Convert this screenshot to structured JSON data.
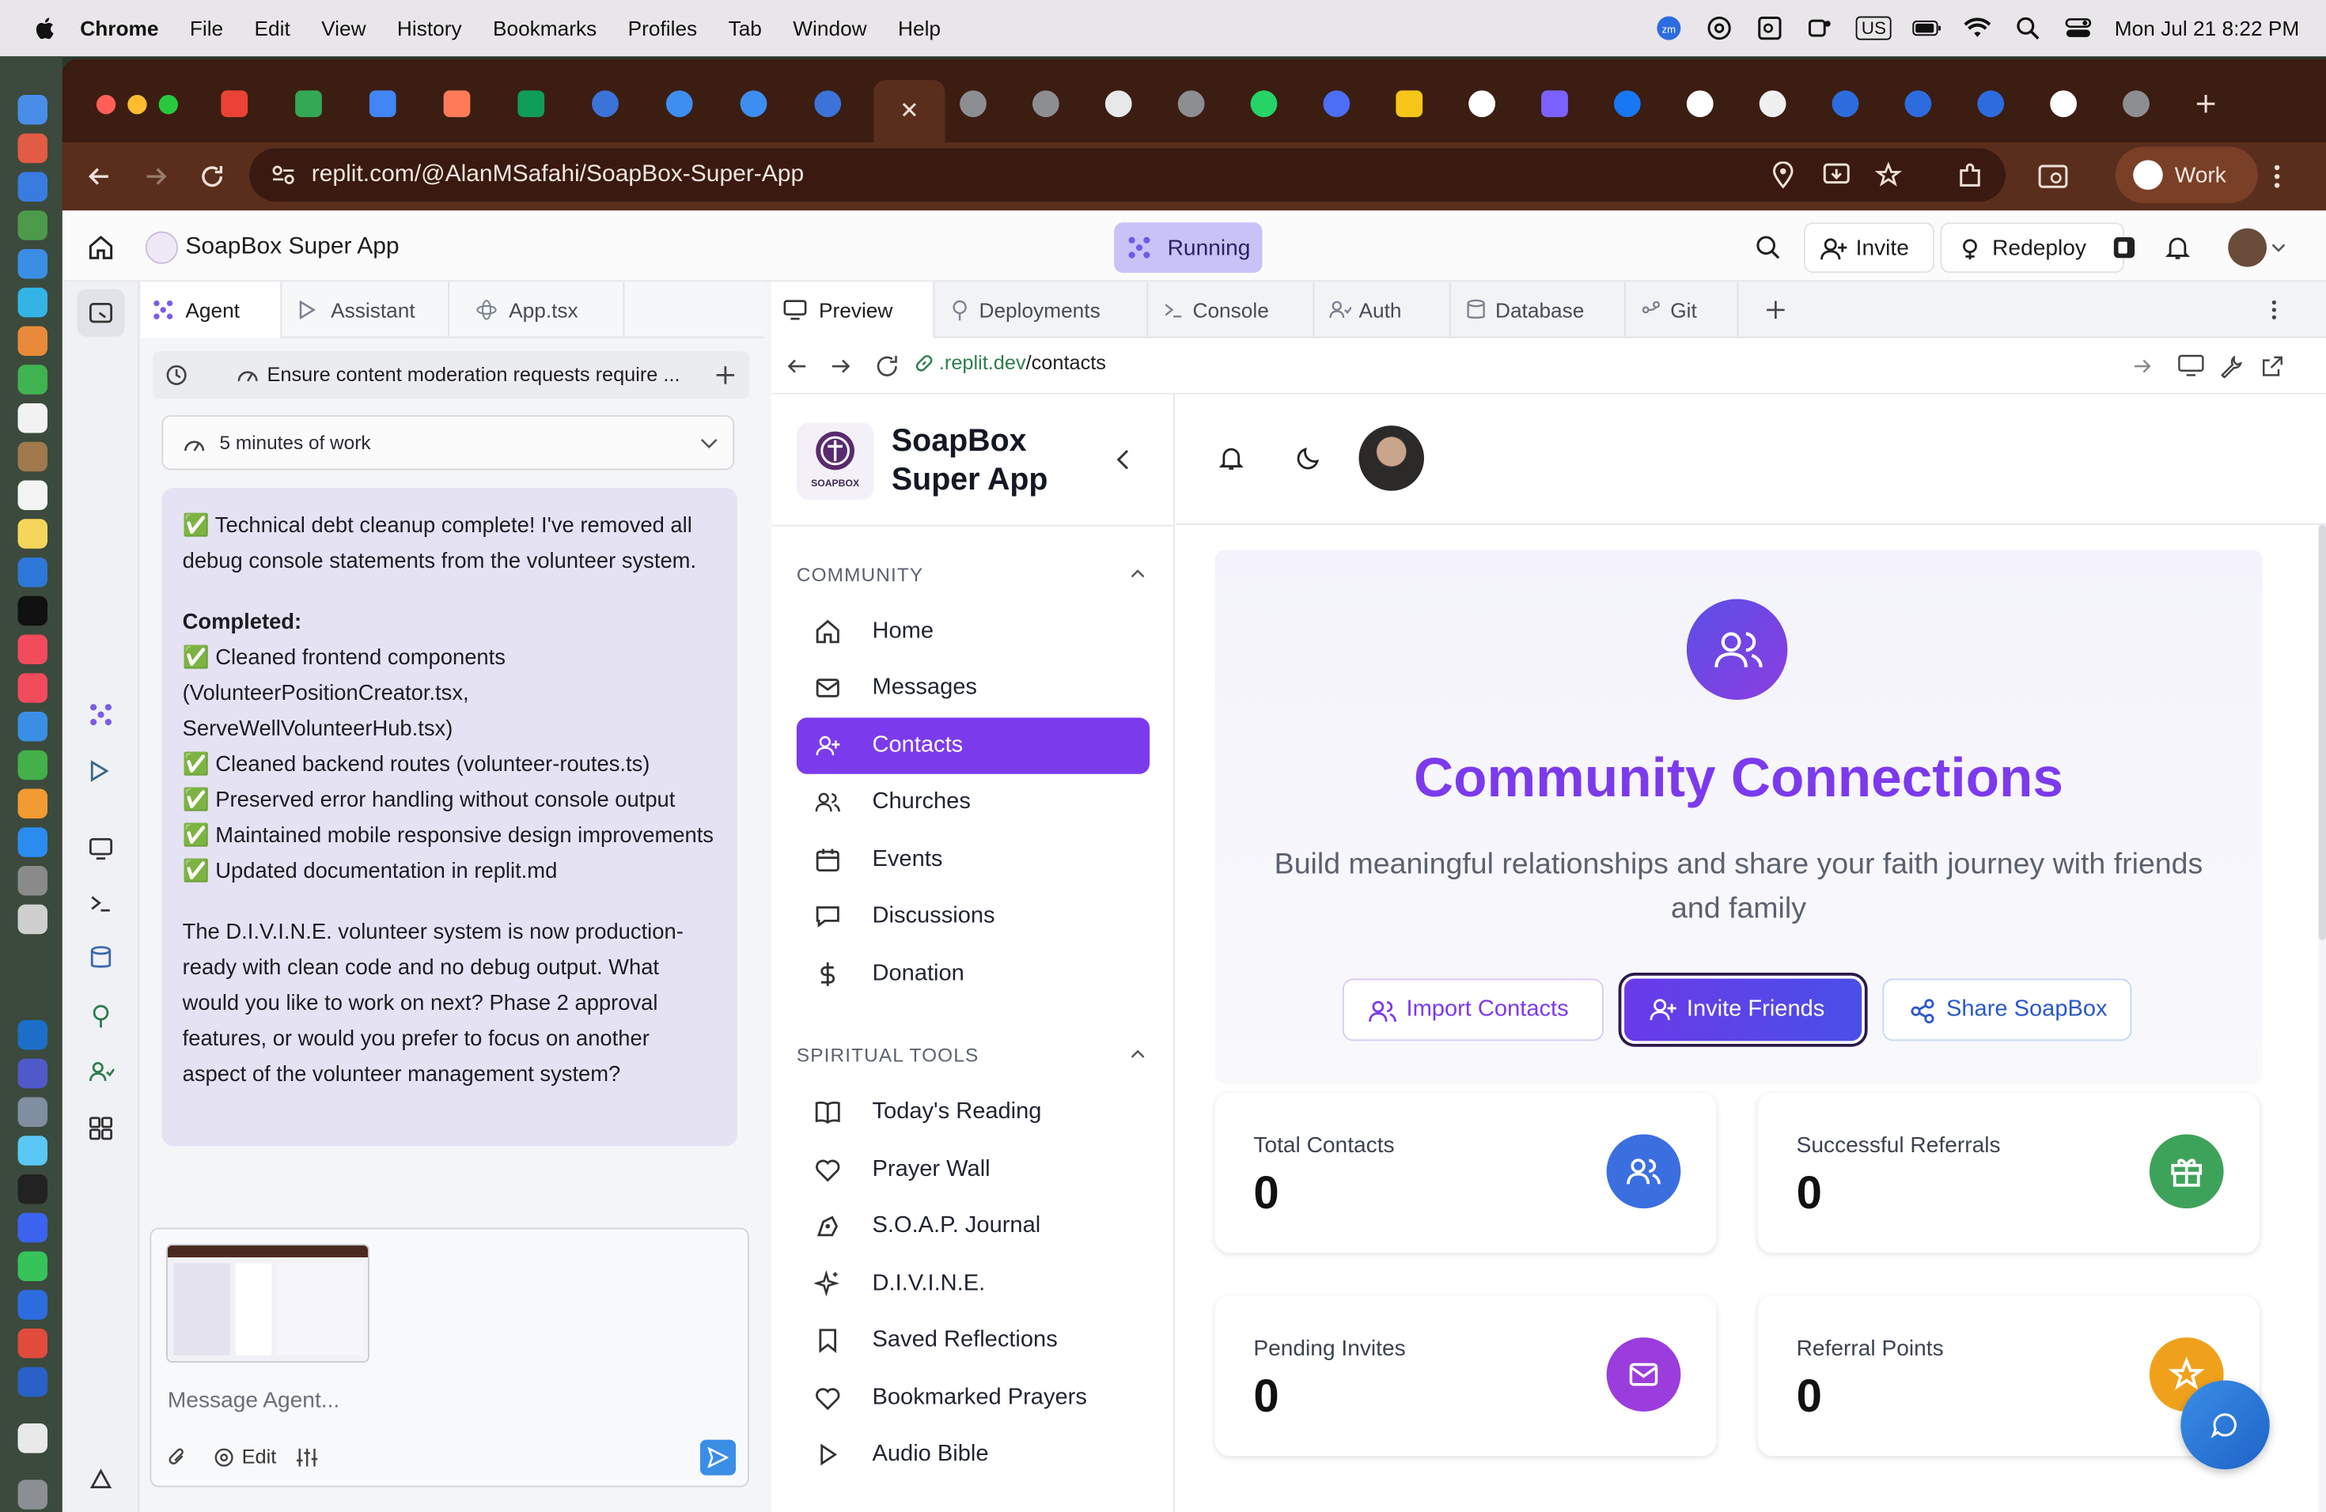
{
  "menubar": {
    "app": "Chrome",
    "items": [
      "File",
      "Edit",
      "View",
      "History",
      "Bookmarks",
      "Profiles",
      "Tab",
      "Window",
      "Help"
    ],
    "input_source": "US",
    "datetime": "Mon Jul 21  8:22 PM"
  },
  "browser": {
    "url": "replit.com/@AlanMSafahi/SoapBox-Super-App",
    "profile": "Work"
  },
  "replit": {
    "project_title": "SoapBox Super App",
    "status": "Running",
    "invite": "Invite",
    "redeploy": "Redeploy",
    "left_tabs": [
      "Agent",
      "Assistant",
      "App.tsx"
    ],
    "checkpoint_title": "Ensure content moderation requests require ...",
    "work_summary": "5 minutes of work",
    "message": {
      "intro": "✅ Technical debt cleanup complete! I've removed all debug console statements from the volunteer system.",
      "completed_label": "Completed:",
      "items": [
        "✅ Cleaned frontend components (VolunteerPositionCreator.tsx, ServeWellVolunteerHub.tsx)",
        "✅ Cleaned backend routes (volunteer-routes.ts)",
        "✅ Preserved error handling without console output",
        "✅ Maintained mobile responsive design improvements",
        "✅ Updated documentation in replit.md"
      ],
      "outro": "The D.I.V.I.N.E. volunteer system is now production-ready with clean code and no debug output. What would you like to work on next? Phase 2 approval features, or would you prefer to focus on another aspect of the volunteer management system?"
    },
    "composer": {
      "placeholder": "Message Agent...",
      "edit": "Edit"
    },
    "preview_tabs": [
      "Preview",
      "Deployments",
      "Console",
      "Auth",
      "Database",
      "Git"
    ],
    "preview_url_host": ".replit.dev",
    "preview_url_path": "/contacts"
  },
  "soapbox": {
    "brand_line1": "SoapBox",
    "brand_line2": "Super App",
    "logo_text": "SOAPBOX",
    "community_header": "COMMUNITY",
    "community_items": [
      "Home",
      "Messages",
      "Contacts",
      "Churches",
      "Events",
      "Discussions",
      "Donation"
    ],
    "active_item": "Contacts",
    "spiritual_header": "SPIRITUAL TOOLS",
    "spiritual_items": [
      "Today's Reading",
      "Prayer Wall",
      "S.O.A.P. Journal",
      "D.I.V.I.N.E.",
      "Saved Reflections",
      "Bookmarked Prayers",
      "Audio Bible"
    ],
    "hero_title": "Community Connections",
    "hero_subtitle_1": "Build meaningful relationships and share your faith journey with friends",
    "hero_subtitle_2": "and family",
    "buttons": {
      "import": "Import Contacts",
      "invite": "Invite Friends",
      "share": "Share SoapBox"
    },
    "stats": [
      {
        "label": "Total Contacts",
        "value": "0",
        "color": "#3b6fe0"
      },
      {
        "label": "Successful Referrals",
        "value": "0",
        "color": "#3ea35a"
      },
      {
        "label": "Pending Invites",
        "value": "0",
        "color": "#9b3ddc"
      },
      {
        "label": "Referral Points",
        "value": "0",
        "color": "#f0a11c"
      }
    ],
    "accent": "#7c3aed"
  }
}
